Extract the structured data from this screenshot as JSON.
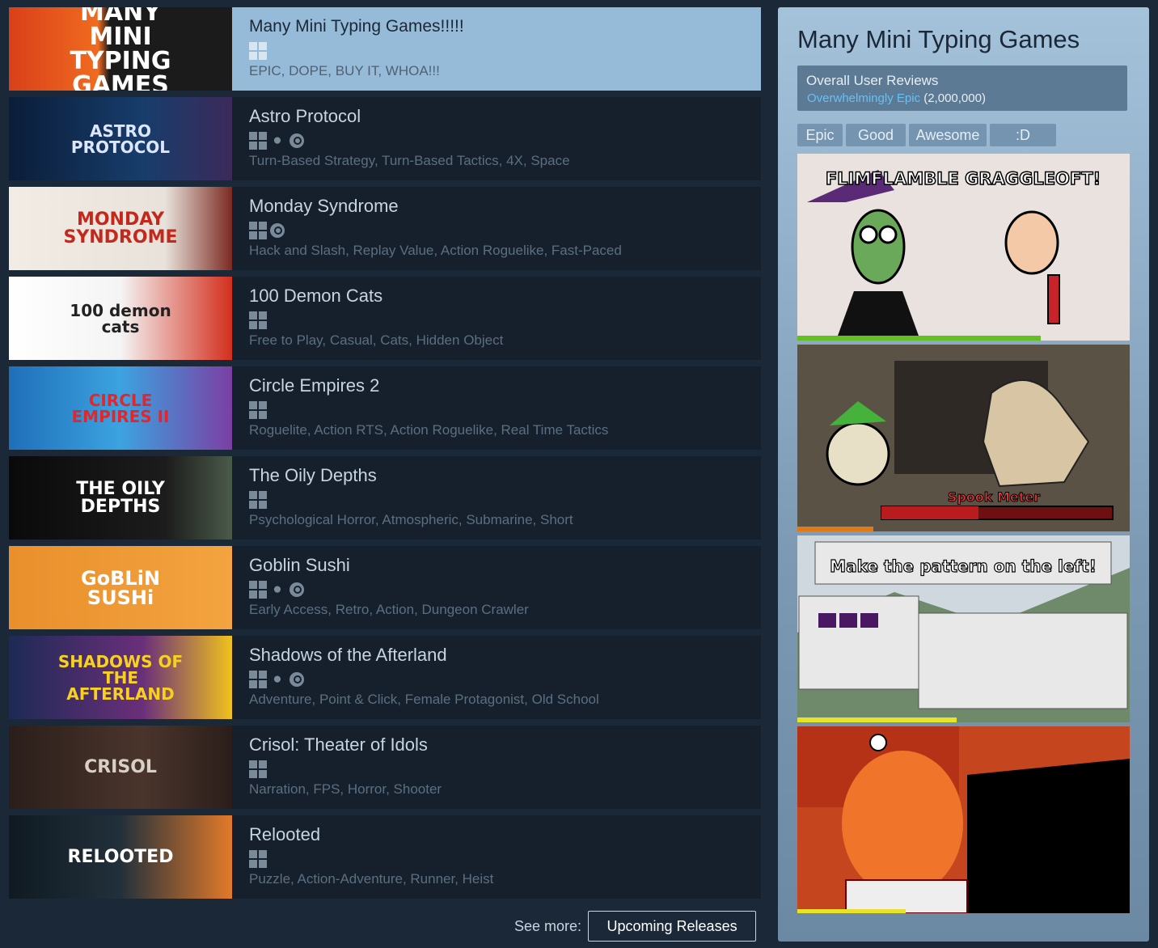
{
  "games": [
    {
      "name": "Many Mini Typing Games!!!!!",
      "platforms": [
        "windows"
      ],
      "tags": "EPIC, DOPE, BUY IT, WHOA!!!",
      "capsule_text": "MANY MINI TYPING GAMES"
    },
    {
      "name": "Astro Protocol",
      "platforms": [
        "windows",
        "mac",
        "steam"
      ],
      "tags": "Turn-Based Strategy, Turn-Based Tactics, 4X, Space",
      "capsule_text": "ASTRO PROTOCOL"
    },
    {
      "name": "Monday Syndrome",
      "platforms": [
        "windows",
        "steam"
      ],
      "tags": "Hack and Slash, Replay Value, Action Roguelike, Fast-Paced",
      "capsule_text": "MONDAY SYNDROME"
    },
    {
      "name": "100 Demon Cats",
      "platforms": [
        "windows"
      ],
      "tags": "Free to Play, Casual, Cats, Hidden Object",
      "capsule_text": "100 demon cats"
    },
    {
      "name": "Circle Empires 2",
      "platforms": [
        "windows"
      ],
      "tags": "Roguelite, Action RTS, Action Roguelike, Real Time Tactics",
      "capsule_text": "CIRCLE EMPIRES II"
    },
    {
      "name": "The Oily Depths",
      "platforms": [
        "windows"
      ],
      "tags": "Psychological Horror, Atmospheric, Submarine, Short",
      "capsule_text": "THE OILY DEPTHS"
    },
    {
      "name": "Goblin Sushi",
      "platforms": [
        "windows",
        "mac",
        "steam"
      ],
      "tags": "Early Access, Retro, Action, Dungeon Crawler",
      "capsule_text": "GoBLiN SUSHi"
    },
    {
      "name": "Shadows of the Afterland",
      "platforms": [
        "windows",
        "mac",
        "steam"
      ],
      "tags": "Adventure, Point & Click, Female Protagonist, Old School",
      "capsule_text": "SHADOWS OF THE AFTERLAND"
    },
    {
      "name": "Crisol: Theater of Idols",
      "platforms": [
        "windows"
      ],
      "tags": "Narration, FPS, Horror, Shooter",
      "capsule_text": "CRISOL"
    },
    {
      "name": "Relooted",
      "platforms": [
        "windows"
      ],
      "tags": "Puzzle, Action-Adventure, Runner, Heist",
      "capsule_text": "RELOOTED"
    }
  ],
  "side": {
    "title": "Many Mini Typing Games",
    "reviews_label": "Overall User Reviews",
    "reviews_summary": "Overwhelmingly Epic",
    "reviews_count": "(2,000,000)",
    "tags": [
      "Epic",
      "Good",
      "Awesome",
      ":D"
    ],
    "shot1_text": "FLIMFLAMBLE GRAGGLEOFT!",
    "shot2_text": "Spook Meter",
    "shot3_text": "Make the pattern on the left!"
  },
  "see_more": {
    "label": "See more:",
    "button": "Upcoming Releases"
  }
}
